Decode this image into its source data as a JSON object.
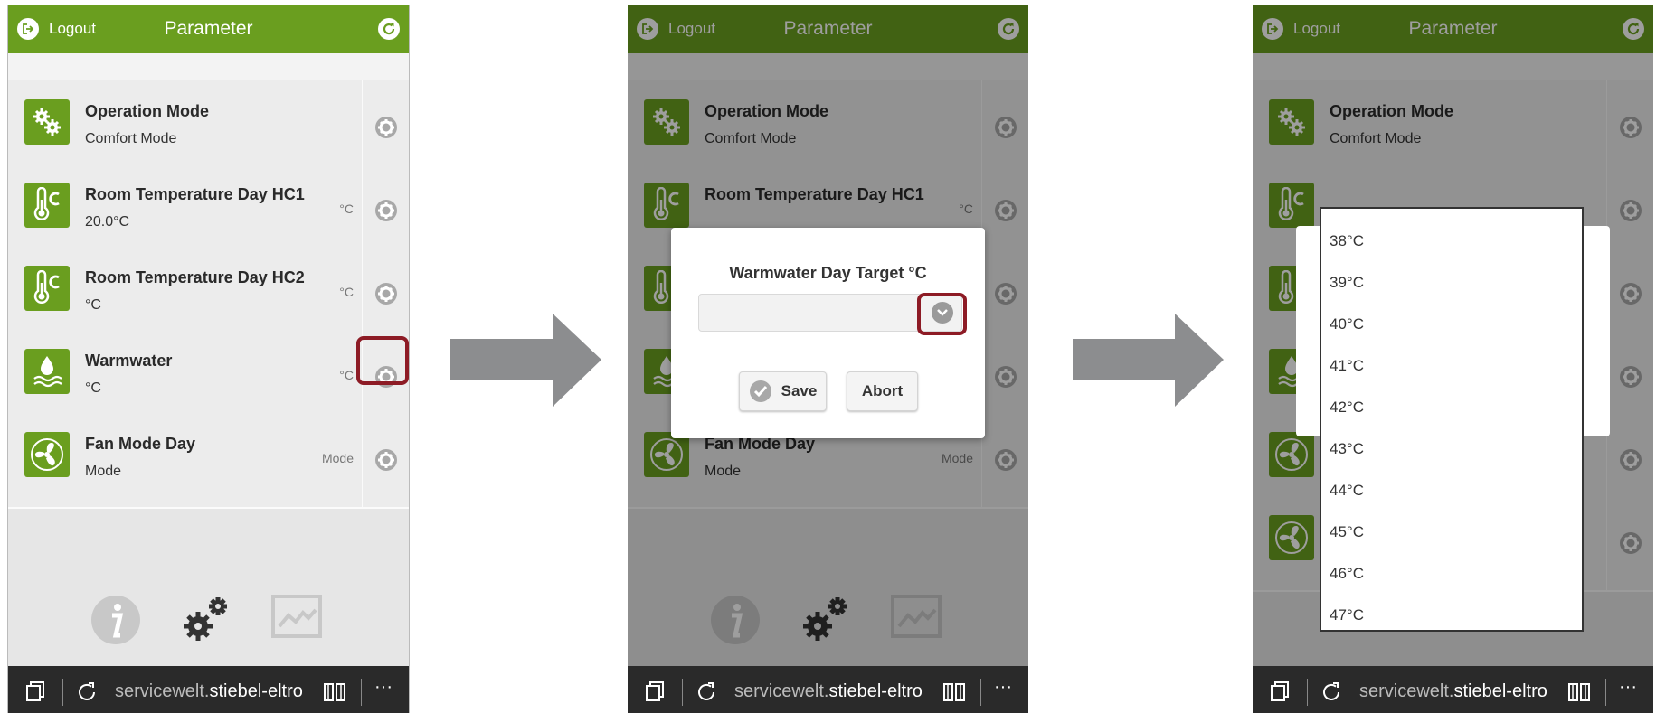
{
  "header": {
    "logout_label": "Logout",
    "title": "Parameter"
  },
  "rows": [
    {
      "title": "Operation Mode",
      "value": "Comfort Mode",
      "unit": "",
      "icon": "gears-icon"
    },
    {
      "title": "Room Temperature Day HC1",
      "value": "20.0°C",
      "unit": "°C",
      "icon": "thermometer-c-icon"
    },
    {
      "title": "Room Temperature Day HC2",
      "value": "°C",
      "unit": "°C",
      "icon": "thermometer-c-icon"
    },
    {
      "title": "Warmwater",
      "value": "°C",
      "unit": "°C",
      "icon": "water-drop-icon"
    },
    {
      "title": "Fan Mode Day",
      "value": "Mode",
      "unit": "Mode",
      "icon": "fan-icon"
    }
  ],
  "footer": {
    "url_prefix": "servicewelt.",
    "url_host": "stiebel-eltro",
    "more": "···"
  },
  "dialog": {
    "title": "Warmwater Day Target °C",
    "select_value": "",
    "save_label": "Save",
    "abort_label": "Abort"
  },
  "dropdown": {
    "options": [
      "38°C",
      "39°C",
      "40°C",
      "41°C",
      "42°C",
      "43°C",
      "44°C",
      "45°C",
      "46°C",
      "47°C"
    ]
  },
  "colors": {
    "brand_green": "#6a9e1f",
    "highlight": "#8d1b25",
    "footer_bg": "#2a2a2a"
  }
}
